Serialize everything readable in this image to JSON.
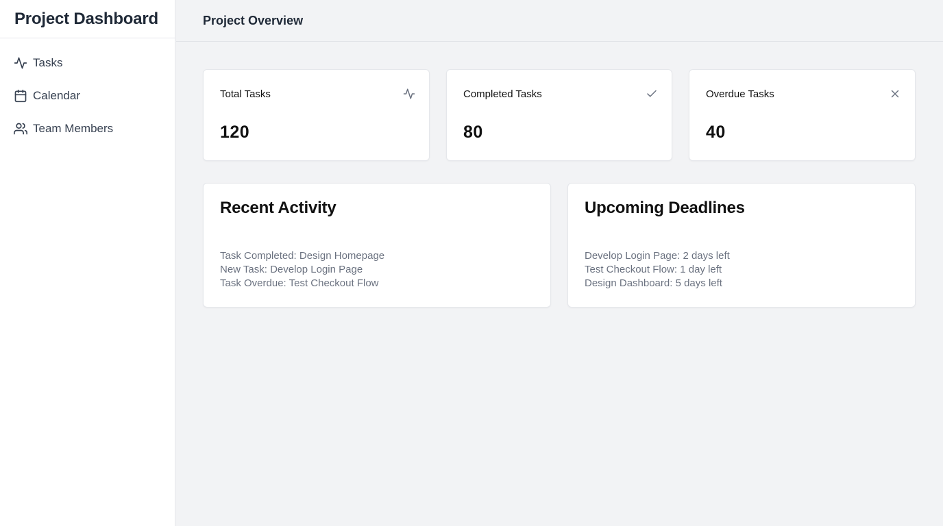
{
  "sidebar": {
    "brand": "Project Dashboard",
    "items": [
      {
        "label": "Tasks",
        "icon": "activity-icon"
      },
      {
        "label": "Calendar",
        "icon": "calendar-icon"
      },
      {
        "label": "Team Members",
        "icon": "users-icon"
      }
    ]
  },
  "header": {
    "title": "Project Overview"
  },
  "stats": [
    {
      "label": "Total Tasks",
      "value": "120",
      "icon": "activity-icon"
    },
    {
      "label": "Completed Tasks",
      "value": "80",
      "icon": "check-icon"
    },
    {
      "label": "Overdue Tasks",
      "value": "40",
      "icon": "x-icon"
    }
  ],
  "recent_activity": {
    "title": "Recent Activity",
    "items": [
      "Task Completed: Design Homepage",
      "New Task: Develop Login Page",
      "Task Overdue: Test Checkout Flow"
    ]
  },
  "upcoming_deadlines": {
    "title": "Upcoming Deadlines",
    "items": [
      "Develop Login Page: 2 days left",
      "Test Checkout Flow: 1 day left",
      "Design Dashboard: 5 days left"
    ]
  },
  "colors": {
    "sidebar_bg": "#ffffff",
    "main_bg": "#f2f3f5",
    "card_bg": "#ffffff",
    "muted_text": "#6b7280"
  }
}
